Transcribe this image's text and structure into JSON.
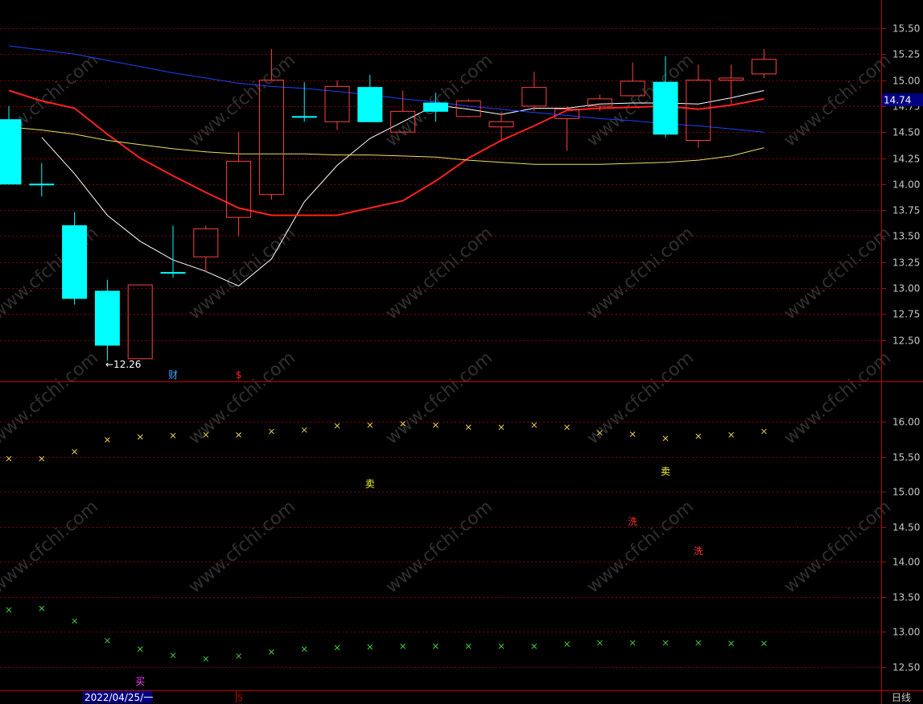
{
  "chart_data": [
    {
      "type": "candlestick",
      "panel": "price",
      "ylim": [
        12.0,
        15.75
      ],
      "y_ticks": [
        "15.50",
        "15.25",
        "15.00",
        "14.75",
        "14.50",
        "14.25",
        "14.00",
        "13.75",
        "13.50",
        "13.25",
        "13.00",
        "12.75",
        "12.50"
      ],
      "current_price": "14.74",
      "min_label": "←12.26",
      "candles": [
        {
          "o": 14.62,
          "h": 14.75,
          "l": 14.0,
          "c": 14.0
        },
        {
          "o": 14.0,
          "h": 14.2,
          "l": 13.88,
          "c": 14.0
        },
        {
          "o": 13.6,
          "h": 13.73,
          "l": 12.84,
          "c": 12.9
        },
        {
          "o": 12.97,
          "h": 13.08,
          "l": 12.3,
          "c": 12.45
        },
        {
          "o": 12.32,
          "h": 13.03,
          "l": 12.32,
          "c": 13.03
        },
        {
          "o": 13.15,
          "h": 13.6,
          "l": 13.1,
          "c": 13.15
        },
        {
          "o": 13.3,
          "h": 13.6,
          "l": 13.15,
          "c": 13.57
        },
        {
          "o": 13.68,
          "h": 14.5,
          "l": 13.5,
          "c": 14.22
        },
        {
          "o": 13.9,
          "h": 15.3,
          "l": 13.85,
          "c": 15.0
        },
        {
          "o": 14.65,
          "h": 14.98,
          "l": 14.6,
          "c": 14.65
        },
        {
          "o": 14.6,
          "h": 15.0,
          "l": 14.52,
          "c": 14.94
        },
        {
          "o": 14.93,
          "h": 15.05,
          "l": 14.6,
          "c": 14.6
        },
        {
          "o": 14.5,
          "h": 14.9,
          "l": 14.5,
          "c": 14.7
        },
        {
          "o": 14.78,
          "h": 14.88,
          "l": 14.6,
          "c": 14.7
        },
        {
          "o": 14.65,
          "h": 14.82,
          "l": 14.64,
          "c": 14.8
        },
        {
          "o": 14.55,
          "h": 14.7,
          "l": 14.42,
          "c": 14.6
        },
        {
          "o": 14.75,
          "h": 15.08,
          "l": 14.7,
          "c": 14.93
        },
        {
          "o": 14.63,
          "h": 14.75,
          "l": 14.32,
          "c": 14.72
        },
        {
          "o": 14.75,
          "h": 14.86,
          "l": 14.7,
          "c": 14.82
        },
        {
          "o": 14.85,
          "h": 15.17,
          "l": 14.85,
          "c": 14.99
        },
        {
          "o": 14.98,
          "h": 15.23,
          "l": 14.45,
          "c": 14.48
        },
        {
          "o": 14.42,
          "h": 15.15,
          "l": 14.35,
          "c": 15.0
        },
        {
          "o": 15.0,
          "h": 15.15,
          "l": 14.77,
          "c": 15.02
        },
        {
          "o": 15.06,
          "h": 15.3,
          "l": 15.02,
          "c": 15.2
        }
      ],
      "series": [
        {
          "color": "#ffffff",
          "values": [
            null,
            14.45,
            14.1,
            13.7,
            13.45,
            13.27,
            13.16,
            13.02,
            13.28,
            13.83,
            14.18,
            14.44,
            14.6,
            14.76,
            14.72,
            14.67,
            14.73,
            14.73,
            14.77,
            14.78,
            14.78,
            14.77,
            14.83,
            14.9
          ]
        },
        {
          "color": "#ff2020",
          "values": [
            14.9,
            14.8,
            14.73,
            14.48,
            14.25,
            14.08,
            13.92,
            13.77,
            13.7,
            13.7,
            13.7,
            13.77,
            13.84,
            14.03,
            14.25,
            14.42,
            14.56,
            14.71,
            14.73,
            14.74,
            14.75,
            14.72,
            14.76,
            14.82
          ]
        },
        {
          "color": "#2040ff",
          "values": [
            15.33,
            15.29,
            15.25,
            15.19,
            15.13,
            15.07,
            15.02,
            14.97,
            14.94,
            14.92,
            14.89,
            14.86,
            14.82,
            14.79,
            14.75,
            14.72,
            14.69,
            14.66,
            14.63,
            14.61,
            14.58,
            14.56,
            14.53,
            14.5
          ]
        },
        {
          "color": "#e8e060",
          "values": [
            14.55,
            14.52,
            14.48,
            14.42,
            14.38,
            14.34,
            14.31,
            14.29,
            14.29,
            14.29,
            14.28,
            14.28,
            14.27,
            14.26,
            14.23,
            14.21,
            14.19,
            14.19,
            14.19,
            14.2,
            14.21,
            14.23,
            14.27,
            14.35
          ]
        }
      ],
      "markers": [
        {
          "text": "财",
          "index": 5,
          "color": "#40a0ff"
        },
        {
          "text": "$",
          "index": 7,
          "color": "#ff2020"
        }
      ]
    },
    {
      "type": "scatter",
      "panel": "indicator",
      "ylim": [
        12.25,
        16.5
      ],
      "y_ticks": [
        "16.00",
        "15.50",
        "15.00",
        "14.50",
        "14.00",
        "13.50",
        "13.00",
        "12.50"
      ],
      "series": [
        {
          "color": "#e8d050",
          "values": [
            15.47,
            15.47,
            15.57,
            15.74,
            15.78,
            15.8,
            15.81,
            15.81,
            15.86,
            15.88,
            15.94,
            15.95,
            15.97,
            15.95,
            15.92,
            15.92,
            15.95,
            15.92,
            15.84,
            15.82,
            15.76,
            15.79,
            15.81,
            15.86
          ]
        },
        {
          "color": "#40d040",
          "values": [
            13.31,
            13.33,
            13.15,
            12.87,
            12.75,
            12.66,
            12.61,
            12.65,
            12.71,
            12.75,
            12.77,
            12.78,
            12.79,
            12.79,
            12.79,
            12.79,
            12.79,
            12.82,
            12.84,
            12.84,
            12.84,
            12.84,
            12.83,
            12.83
          ]
        }
      ],
      "signals": [
        {
          "text": "卖",
          "index": 11,
          "y": 15.11,
          "color": "#ffff40"
        },
        {
          "text": "卖",
          "index": 20,
          "y": 15.29,
          "color": "#ffff40"
        },
        {
          "text": "洗",
          "index": 19,
          "y": 14.57,
          "color": "#ff3030"
        },
        {
          "text": "洗",
          "index": 21,
          "y": 14.15,
          "color": "#ff3030"
        },
        {
          "text": "买",
          "index": 4,
          "y": 12.29,
          "color": "#ff40ff"
        }
      ]
    }
  ],
  "footer": {
    "date_label": "2022/04/25/一",
    "marker_label": "5",
    "period_label": "日线"
  },
  "watermark": "www.cfchi.com",
  "colors": {
    "up": "#ff4040",
    "down": "#00ffff",
    "grid": "#800000",
    "border": "#c00000",
    "axis_text": "#c8c8c8"
  }
}
